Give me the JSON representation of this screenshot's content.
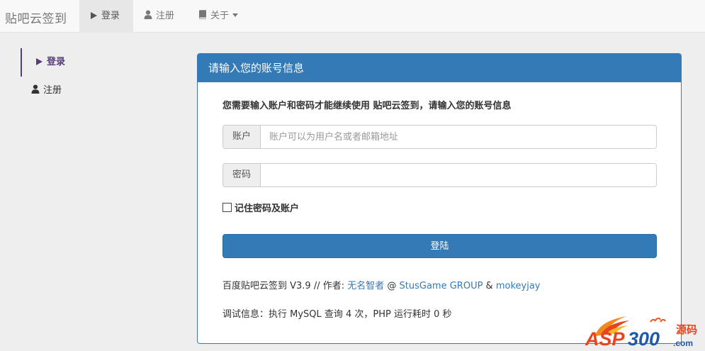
{
  "navbar": {
    "brand": "贴吧云签到",
    "items": [
      {
        "label": "登录",
        "icon": "play-icon",
        "active": true
      },
      {
        "label": "注册",
        "icon": "user-icon",
        "active": false
      },
      {
        "label": "关于",
        "icon": "book-icon",
        "active": false,
        "dropdown": true
      }
    ]
  },
  "sidebar": {
    "items": [
      {
        "label": "登录",
        "icon": "play-icon",
        "active": true
      },
      {
        "label": "注册",
        "icon": "user-icon",
        "active": false
      }
    ]
  },
  "panel": {
    "heading": "请输入您的账号信息",
    "intro": "您需要输入账户和密码才能继续使用 贴吧云签到，请输入您的账号信息",
    "account": {
      "label": "账户",
      "placeholder": "账户可以为用户名或者邮箱地址",
      "value": ""
    },
    "password": {
      "label": "密码",
      "value": ""
    },
    "remember_label": "记住密码及账户",
    "remember_checked": false,
    "submit_label": "登陆",
    "credits": {
      "prefix": "百度贴吧云签到 V3.9 // 作者: ",
      "author": "无名智者",
      "at": " @ ",
      "group": "StusGame GROUP",
      "amp": " & ",
      "coauthor": "mokeyjay"
    },
    "debug": "调试信息：执行 MySQL 查询 4 次，PHP 运行耗时 0 秒"
  },
  "watermark": {
    "text_asp": "ASP",
    "text_num": "300",
    "text_cn": "源码",
    "text_com": ".com"
  },
  "colors": {
    "primary": "#337ab7",
    "sidebar_accent": "#563d7c",
    "background": "#eeeeee",
    "navbar_bg": "#f8f8f8"
  }
}
